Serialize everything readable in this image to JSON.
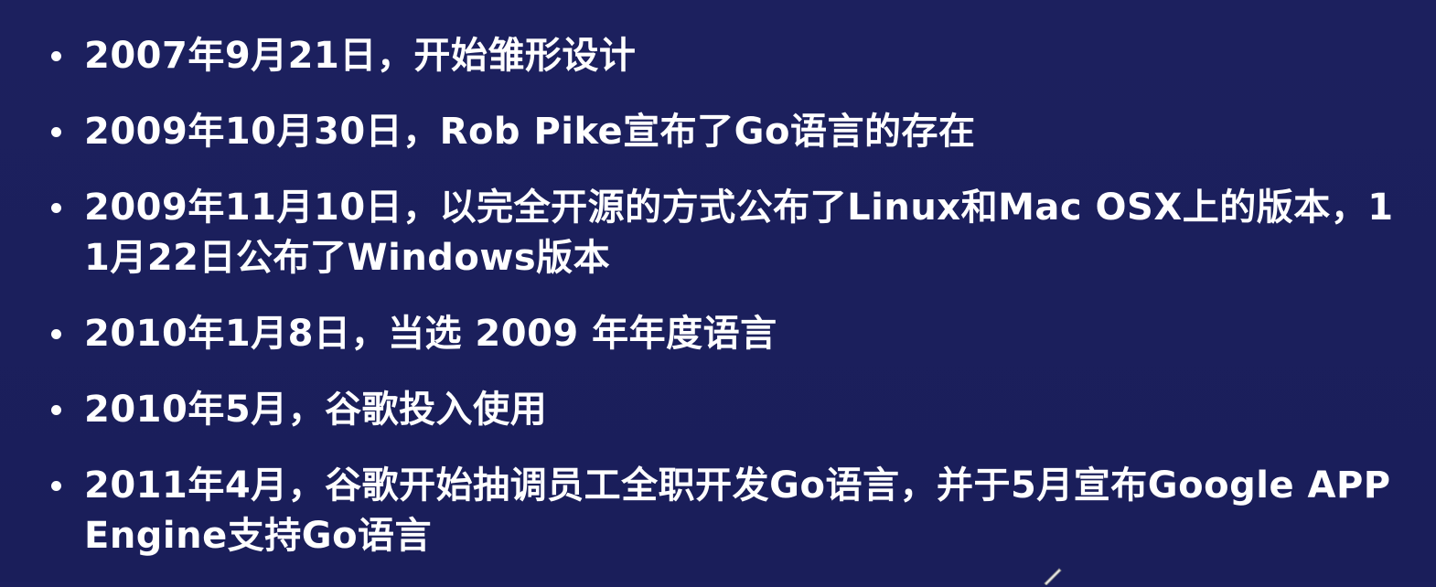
{
  "bullets": [
    "2007年9月21日，开始雏形设计",
    "2009年10月30日，Rob Pike宣布了Go语言的存在",
    "2009年11月10日，以完全开源的方式公布了Linux和Mac OSX上的版本，11月22日公布了Windows版本",
    "2010年1月8日，当选 2009 年年度语言",
    "2010年5月，谷歌投入使用",
    "2011年4月，谷歌开始抽调员工全职开发Go语言，并于5月宣布Google APP Engine支持Go语言"
  ],
  "colors": {
    "background": "#1b1f5c",
    "text": "#ffffff"
  }
}
